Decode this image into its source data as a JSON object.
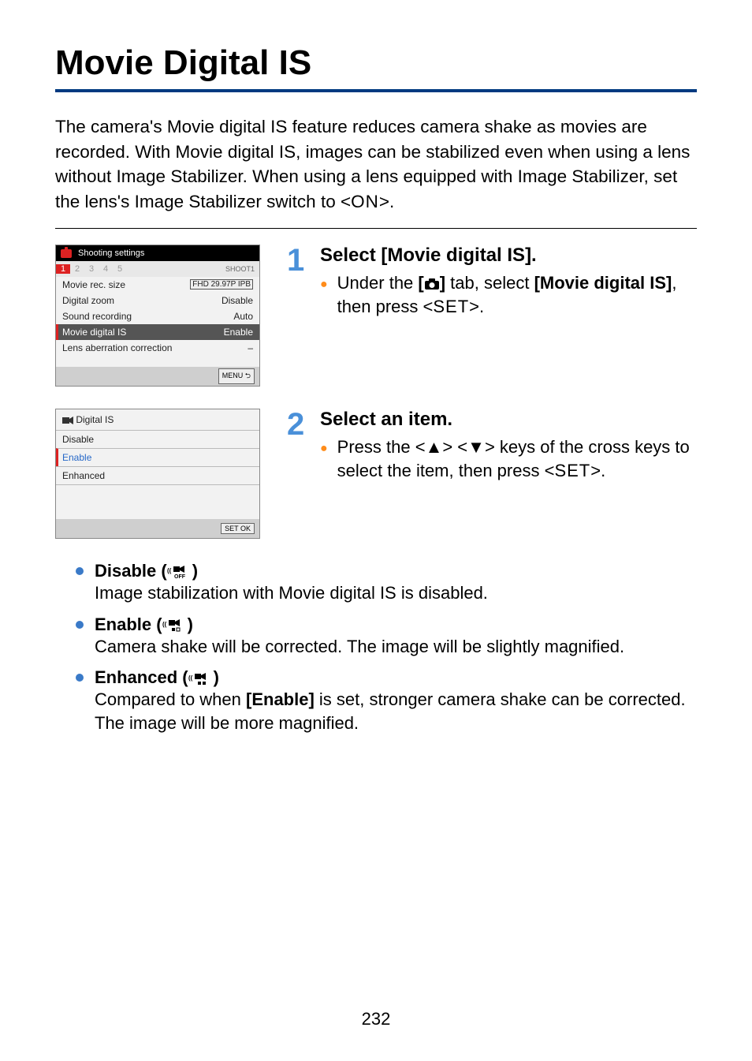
{
  "title": "Movie Digital IS",
  "intro_parts": {
    "p1": "The camera's Movie digital IS feature reduces camera shake as movies are recorded. With Movie digital IS, images can be stabilized even when using a lens without Image Stabilizer. When using a lens equipped with Image Stabilizer, set the lens's Image Stabilizer switch to <",
    "on": "ON",
    "p2": ">."
  },
  "screen1": {
    "header": "Shooting settings",
    "tabs": [
      "1",
      "2",
      "3",
      "4",
      "5"
    ],
    "shoot": "SHOOT1",
    "items": [
      {
        "label": "Movie rec. size",
        "value": "FHD 29.97P IPB"
      },
      {
        "label": "Digital zoom",
        "value": "Disable"
      },
      {
        "label": "Sound recording",
        "value": "Auto"
      },
      {
        "label": "Movie digital IS",
        "value": "Enable"
      },
      {
        "label": "Lens aberration correction",
        "value": "–"
      }
    ],
    "menu_btn": "MENU ⮌"
  },
  "screen2": {
    "title": "Digital IS",
    "options": [
      "Disable",
      "Enable",
      "Enhanced"
    ],
    "set_btn": "SET  OK"
  },
  "step1": {
    "num": "1",
    "heading": "Select [Movie digital IS].",
    "bullet_parts": {
      "a": "Under the ",
      "b": "[",
      "c": "]",
      "d": " tab, select ",
      "e": "[Movie digital IS]",
      "f": ", then press <",
      "g": "SET",
      "h": ">."
    }
  },
  "step2": {
    "num": "2",
    "heading": "Select an item.",
    "bullet_parts": {
      "a": "Press the <",
      "up": "▲",
      "b": "> <",
      "dn": "▼",
      "c": "> keys of the cross keys to select the item, then press <",
      "set": "SET",
      "d": ">."
    }
  },
  "options": [
    {
      "head": "Disable (",
      "icon_sub": "OFF",
      "close": ")",
      "desc": "Image stabilization with Movie digital IS is disabled."
    },
    {
      "head": "Enable (",
      "icon_sub": "▪▫",
      "close": ")",
      "desc": "Camera shake will be corrected. The image will be slightly magnified."
    },
    {
      "head": "Enhanced (",
      "icon_sub": "▪▪",
      "close": ")",
      "desc_parts": {
        "a": "Compared to when ",
        "b": "[Enable]",
        "c": " is set, stronger camera shake can be corrected. The image will be more magnified."
      }
    }
  ],
  "page_number": "232"
}
